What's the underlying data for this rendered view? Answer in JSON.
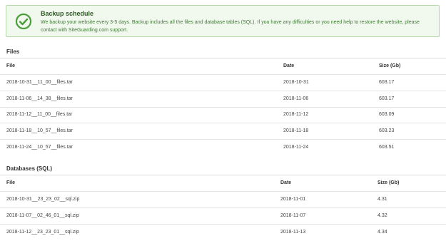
{
  "notice": {
    "title": "Backup schedule",
    "text": "We backup your website every 3-5 days. Backup includes all the files and database tables (SQL). If you have any difficulties or you need help to restore the website, please contact with SiteGuarding.com support.",
    "icon": "check-circle-icon",
    "accent": "#4b9c3a"
  },
  "files": {
    "title": "Files",
    "columns": [
      "File",
      "Date",
      "Size (Gb)"
    ],
    "rows": [
      [
        "2018-10-31__11_00__files.tar",
        "2018-10-31",
        "603.17"
      ],
      [
        "2018-11-06__14_38__files.tar",
        "2018-11-06",
        "603.17"
      ],
      [
        "2018-11-12__11_00__files.tar",
        "2018-11-12",
        "603.09"
      ],
      [
        "2018-11-18__10_57__files.tar",
        "2018-11-18",
        "603.23"
      ],
      [
        "2018-11-24__10_57__files.tar",
        "2018-11-24",
        "603.51"
      ]
    ]
  },
  "databases": {
    "title": "Databases (SQL)",
    "columns": [
      "File",
      "Date",
      "Size (Gb)"
    ],
    "rows": [
      [
        "2018-10-31__23_23_02__sql.zip",
        "2018-11-01",
        "4.31"
      ],
      [
        "2018-11-07__02_46_01__sql.zip",
        "2018-11-07",
        "4.32"
      ],
      [
        "2018-11-12__23_23_01__sql.zip",
        "2018-11-13",
        "4.34"
      ]
    ]
  }
}
